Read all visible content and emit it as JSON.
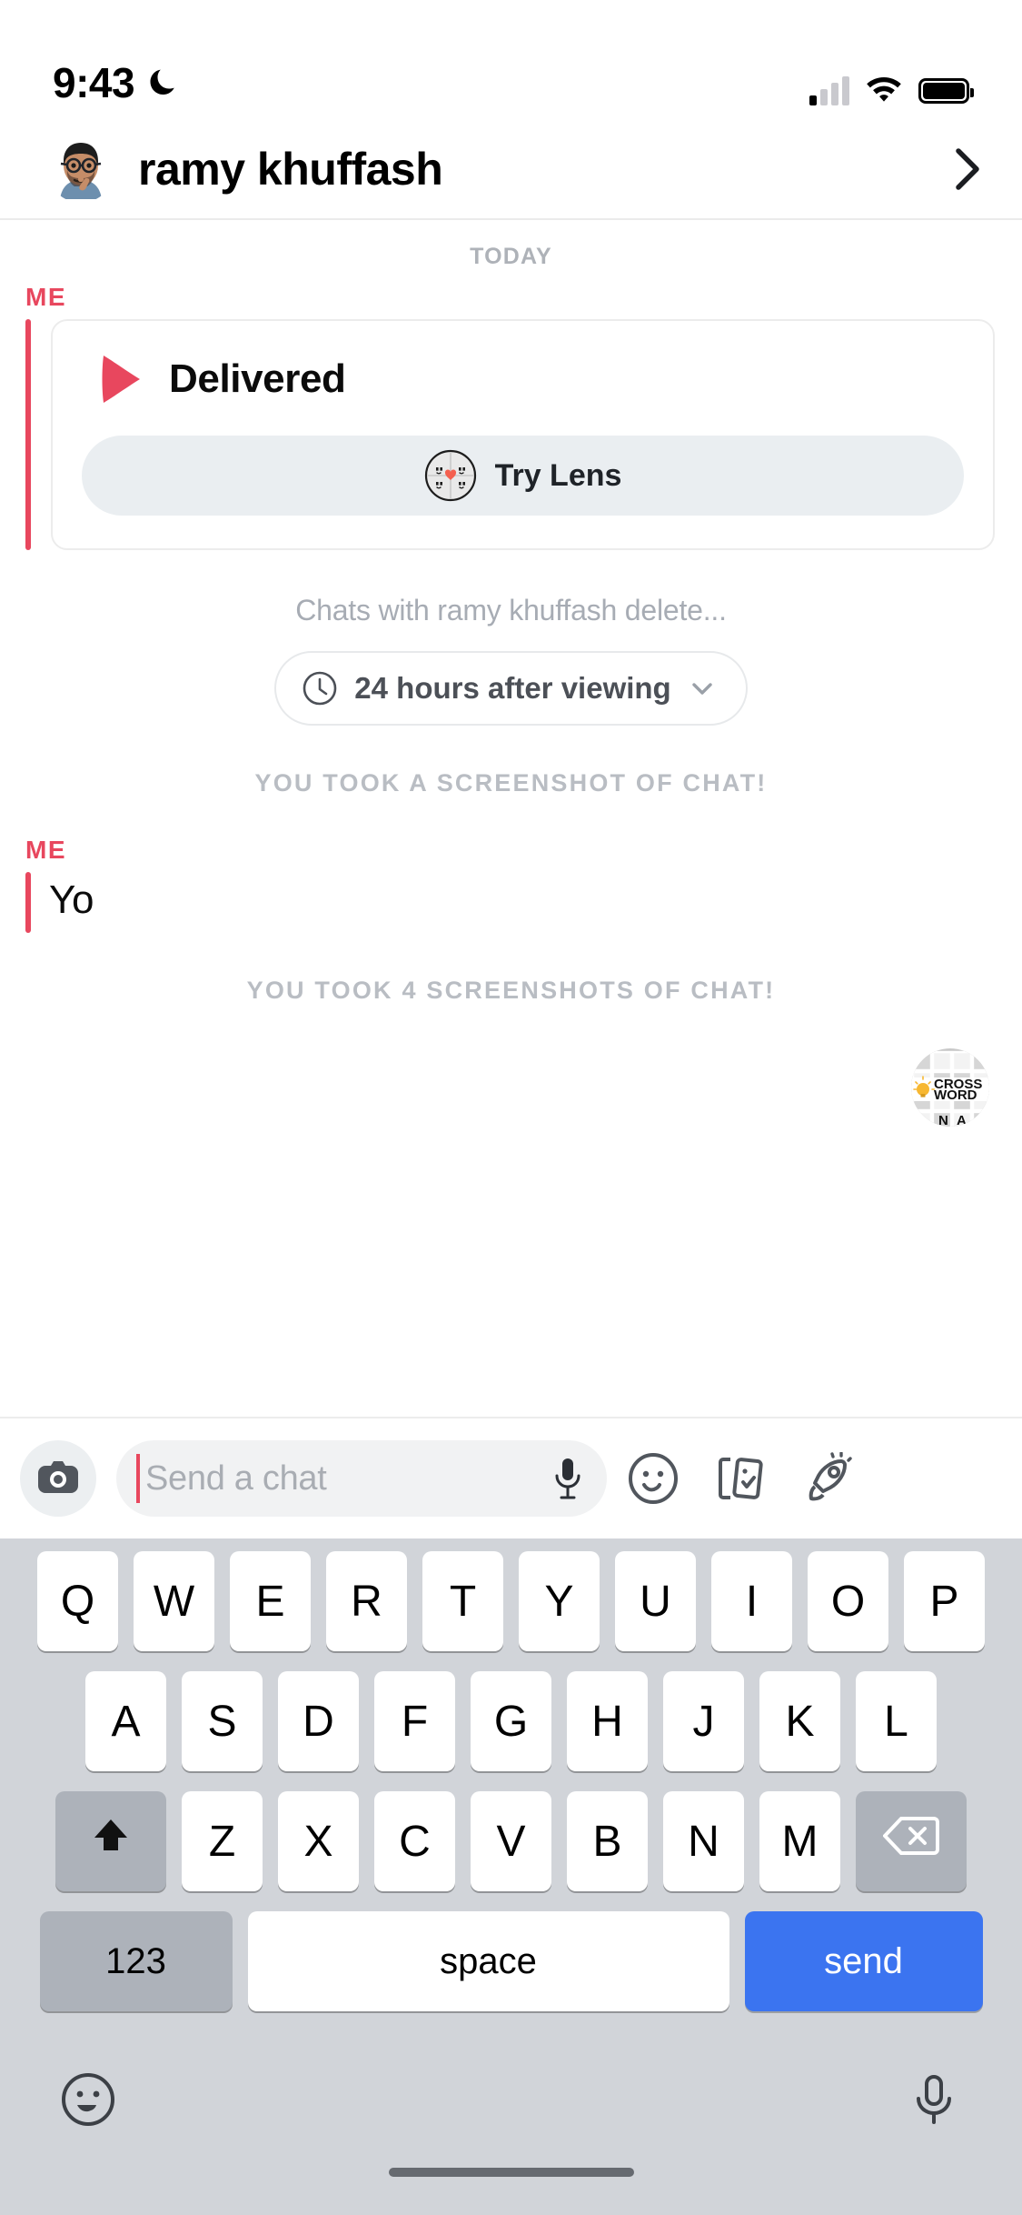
{
  "status_bar": {
    "time": "9:43",
    "dnd_icon": "moon-icon",
    "signal_icon": "cellular-signal-icon",
    "wifi_icon": "wifi-icon",
    "battery_icon": "battery-icon"
  },
  "header": {
    "avatar_icon": "bitmoji-avatar",
    "name": "ramy khuffash",
    "forward_icon": "chevron-right-icon"
  },
  "conversation": {
    "day_divider": "TODAY",
    "messages": [
      {
        "sender_label": "ME",
        "type": "snap_card",
        "status": "Delivered",
        "status_icon": "delivered-arrow-icon",
        "lens_button": {
          "label": "Try Lens",
          "icon": "lens-icon"
        }
      },
      {
        "type": "delete_notice",
        "text": "Chats with ramy khuffash delete...",
        "timer": {
          "icon": "clock-icon",
          "label": "24 hours after viewing",
          "chevron": "chevron-down-icon"
        }
      },
      {
        "type": "system_note",
        "text": "YOU TOOK A SCREENSHOT OF CHAT!"
      },
      {
        "sender_label": "ME",
        "type": "text",
        "text": "Yo"
      },
      {
        "type": "system_note",
        "text": "YOU TOOK 4 SCREENSHOTS OF CHAT!"
      },
      {
        "type": "sticker",
        "icon": "crossword-game-icon",
        "line1": "CROSS",
        "line2": "WORD"
      }
    ]
  },
  "input_bar": {
    "camera_icon": "camera-icon",
    "placeholder": "Send a chat",
    "mic_icon": "microphone-icon",
    "actions": [
      {
        "icon": "smiley-face-icon"
      },
      {
        "icon": "sticker-cards-icon"
      },
      {
        "icon": "rocket-icon"
      }
    ]
  },
  "keyboard": {
    "row1": [
      "Q",
      "W",
      "E",
      "R",
      "T",
      "Y",
      "U",
      "I",
      "O",
      "P"
    ],
    "row2": [
      "A",
      "S",
      "D",
      "F",
      "G",
      "H",
      "J",
      "K",
      "L"
    ],
    "row3": [
      "Z",
      "X",
      "C",
      "V",
      "B",
      "N",
      "M"
    ],
    "shift_icon": "shift-up-icon",
    "backspace_icon": "backspace-icon",
    "numbers_key": "123",
    "space_key": "space",
    "send_key": "send",
    "emoji_icon": "emoji-keyboard-icon",
    "dictation_icon": "dictation-microphone-icon"
  },
  "colors": {
    "accent_red": "#e8475e",
    "send_blue": "#3b74f0",
    "muted_gray": "#aeb2b8",
    "keyboard_bg": "#d1d4d9"
  }
}
